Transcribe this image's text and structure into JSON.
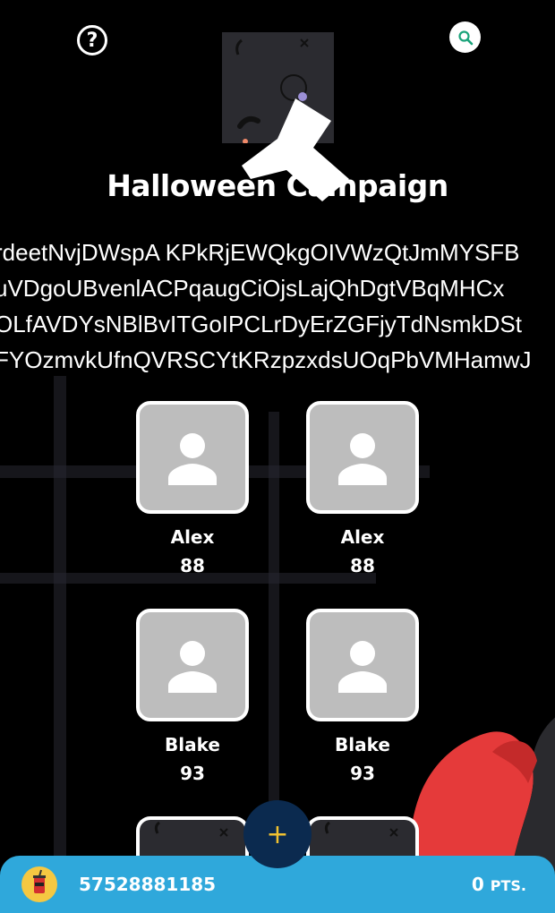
{
  "header": {
    "help_icon": "question-circle-icon",
    "help_glyph": "?",
    "search_icon": "search-icon"
  },
  "campaign": {
    "title": "Halloween Campaign",
    "description_lines": [
      "rdeetNvjDWspA KPkRjEWQkgOIVWzQtJmMYSFB",
      "uVDgoUBvenlACPqaugCiOjsLajQhDgtVBqMHCx",
      "OLfAVDYsNBlBvITGoIPCLrDyErZGFjyTdNsmkDSt",
      "FYOzmvkUfnQVRSCYtKRzpzxdsUOqPbVMHamwJ"
    ]
  },
  "members": [
    {
      "name": "Alex",
      "score": "88"
    },
    {
      "name": "Alex",
      "score": "88"
    },
    {
      "name": "Blake",
      "score": "93"
    },
    {
      "name": "Blake",
      "score": "93"
    }
  ],
  "add_button": {
    "glyph": "+"
  },
  "footer": {
    "icon": "drink-cup-icon",
    "id": "57528881185",
    "points_value": "0",
    "points_unit": "PTS."
  },
  "colors": {
    "background": "#000000",
    "footer": "#2fa8db",
    "add_button": "#0b2a4f",
    "plus": "#f2c230",
    "avatar_bg": "#bdbdbd",
    "search_accent": "#1aa37a"
  }
}
